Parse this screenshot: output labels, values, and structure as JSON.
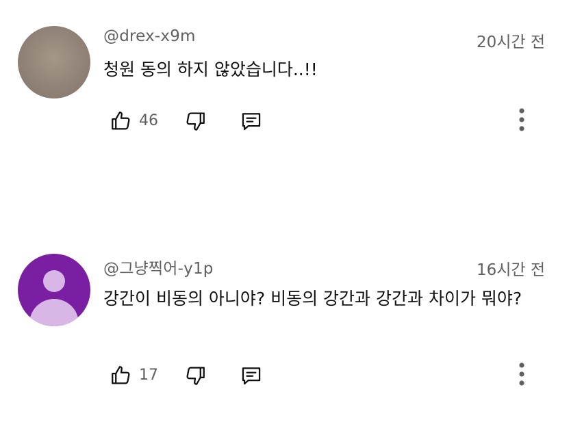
{
  "comments": [
    {
      "handle": "@drex-x9m",
      "time": "20시간 전",
      "text": "청원 동의 하지 않았습니다..!!",
      "likes": "46",
      "avatar": "photo"
    },
    {
      "handle": "@그냥찍어-y1p",
      "time": "16시간 전",
      "text": "강간이 비동의 아니야? 비동의 강간과 강간과 차이가 뭐야?",
      "likes": "17",
      "avatar": "default-person",
      "avatar_color": "#7a1fa2"
    }
  ],
  "icons": {
    "like": "thumbs-up-icon",
    "dislike": "thumbs-down-icon",
    "reply": "comment-icon",
    "more": "more-vertical-icon"
  }
}
